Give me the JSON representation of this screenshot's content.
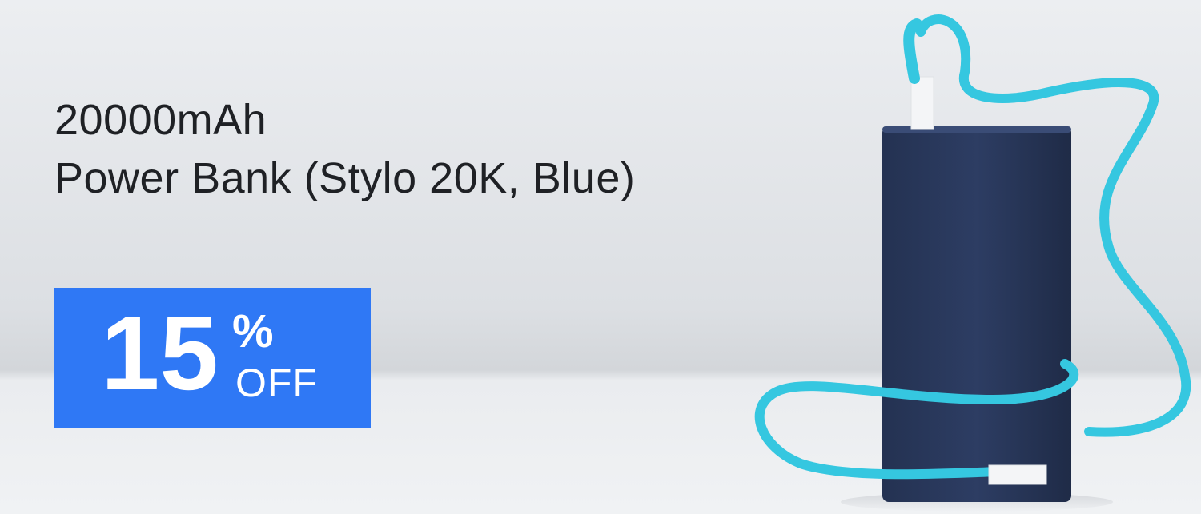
{
  "banner": {
    "headline_line1": "20000mAh",
    "headline_line2": "Power Bank (Stylo 20K, Blue)",
    "badge": {
      "number": "15",
      "percent": "%",
      "off": "OFF",
      "color": "#2f78f5"
    },
    "product_image": {
      "icon": "power-bank-image",
      "body_color": "#2b3a5e",
      "cable_color": "#35c7e0"
    }
  }
}
